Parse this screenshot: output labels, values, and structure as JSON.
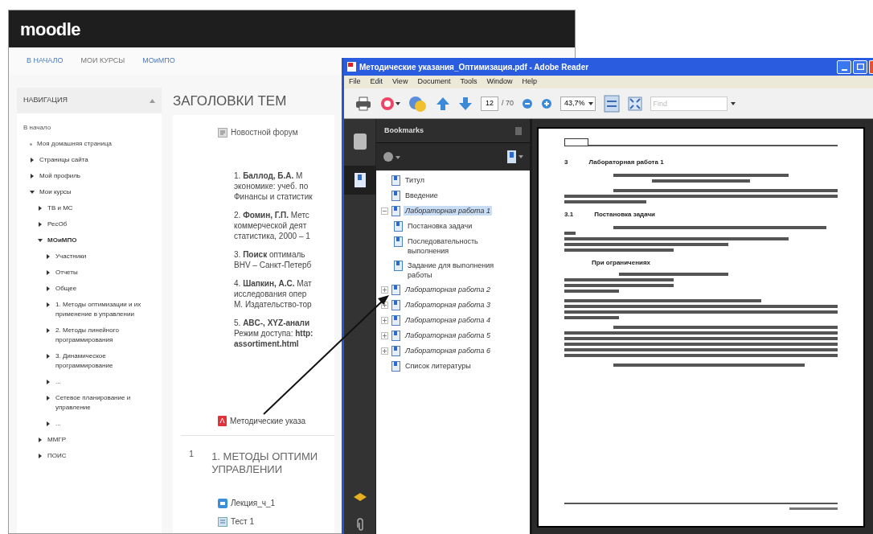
{
  "moodle": {
    "logo": "moodle",
    "nav_links": [
      "В НАЧАЛО",
      "МОИ КУРСЫ",
      "МОиМПО"
    ],
    "navigation": {
      "title": "НАВИГАЦИЯ",
      "items": [
        {
          "label": "В начало",
          "kind": "root",
          "children": [
            {
              "label": "Моя домашняя страница",
              "kind": "leaf"
            },
            {
              "label": "Страницы сайта",
              "kind": "branch",
              "expanded": false
            },
            {
              "label": "Мой профиль",
              "kind": "branch",
              "expanded": false
            },
            {
              "label": "Мои курсы",
              "kind": "branch",
              "expanded": true,
              "children": [
                {
                  "label": "ТВ и МС",
                  "kind": "branch",
                  "expanded": false
                },
                {
                  "label": "РесОб",
                  "kind": "branch",
                  "expanded": false
                },
                {
                  "label": "МОиМПО",
                  "kind": "branch",
                  "expanded": true,
                  "children": [
                    {
                      "label": "Участники",
                      "kind": "branch",
                      "expanded": false
                    },
                    {
                      "label": "Отчеты",
                      "kind": "branch",
                      "expanded": false
                    },
                    {
                      "label": "Общее",
                      "kind": "branch",
                      "expanded": false
                    },
                    {
                      "label": "1. Методы оптимизации и их применение в управлении",
                      "kind": "branch",
                      "expanded": false
                    },
                    {
                      "label": "2. Методы линейного программирования",
                      "kind": "branch",
                      "expanded": false
                    },
                    {
                      "label": "3. Динамическое программирование",
                      "kind": "branch",
                      "expanded": false
                    },
                    {
                      "label": "...",
                      "kind": "branch",
                      "expanded": false
                    },
                    {
                      "label": "Сетевое планирование и управление",
                      "kind": "branch",
                      "expanded": false
                    },
                    {
                      "label": "...",
                      "kind": "branch",
                      "expanded": false
                    }
                  ]
                },
                {
                  "label": "ММГР",
                  "kind": "branch",
                  "expanded": false
                },
                {
                  "label": "ПОИС",
                  "kind": "branch",
                  "expanded": false
                }
              ]
            }
          ]
        }
      ]
    },
    "heading": "ЗАГОЛОВКИ ТЕМ",
    "forum": "Новостной форум",
    "references": [
      {
        "lines": [
          "1.   **Баллод, Б.А.** М",
          "экономике: учеб. по",
          "Финансы и статистик"
        ]
      },
      {
        "lines": [
          "2.  **Фомин, Г.П.** Метс",
          "коммерческой деят",
          "статистика, 2000 – 1"
        ]
      },
      {
        "lines": [
          "3.  **Поиск** оптималь",
          "BHV – Санкт-Петерб"
        ]
      },
      {
        "lines": [
          "4.  **Шапкин, А.С.** Мат",
          "исследования опер",
          "М. Издательство-тор"
        ]
      },
      {
        "lines": [
          "5.  **ABC-, XYZ-анали**",
          "Режим доступа: **http:**",
          "**assortiment.html**"
        ]
      }
    ],
    "pdf_link": "Методические указа",
    "section": {
      "number": "1",
      "title_lines": [
        "1. МЕТОДЫ ОПТИМИ",
        "УПРАВЛЕНИИ"
      ]
    },
    "activities": [
      {
        "kind": "lecture",
        "label": "Лекция_ч_1"
      },
      {
        "kind": "quiz",
        "label": "Тест 1"
      }
    ]
  },
  "reader": {
    "title": "Методические указания_Оптимизация.pdf - Adobe Reader",
    "menu": [
      "File",
      "Edit",
      "View",
      "Document",
      "Tools",
      "Window",
      "Help"
    ],
    "page": "12",
    "page_total": "/ 70",
    "zoom": "43,7%",
    "find_placeholder": "Find",
    "bookmarks_title": "Bookmarks",
    "bookmarks": [
      {
        "label": "Титул",
        "selected": false
      },
      {
        "label": "Введение",
        "selected": false
      },
      {
        "label": "Лабораторная работа 1",
        "selected": true,
        "expanded": true,
        "children": [
          {
            "label": "Постановка задачи",
            "selected": false
          },
          {
            "label": "Последовательность выполнения",
            "selected": false
          },
          {
            "label": "Задание для выполнения работы",
            "selected": false
          }
        ]
      },
      {
        "label": "Лабораторная работа 2",
        "selected": false,
        "expanded": false
      },
      {
        "label": "Лабораторная работа 3",
        "selected": false,
        "expanded": false
      },
      {
        "label": "Лабораторная работа 4",
        "selected": false,
        "expanded": false
      },
      {
        "label": "Лабораторная работа 5",
        "selected": false,
        "expanded": false
      },
      {
        "label": "Лабораторная работа 6",
        "selected": false,
        "expanded": false
      },
      {
        "label": "Список литературы",
        "selected": false
      }
    ],
    "pdf_page": {
      "chapter_number": "3",
      "chapter_title": "Лабораторная работа 1",
      "section_number": "3.1",
      "section_title": "Постановка задачи",
      "constraints_label": "При ограничениях"
    }
  }
}
